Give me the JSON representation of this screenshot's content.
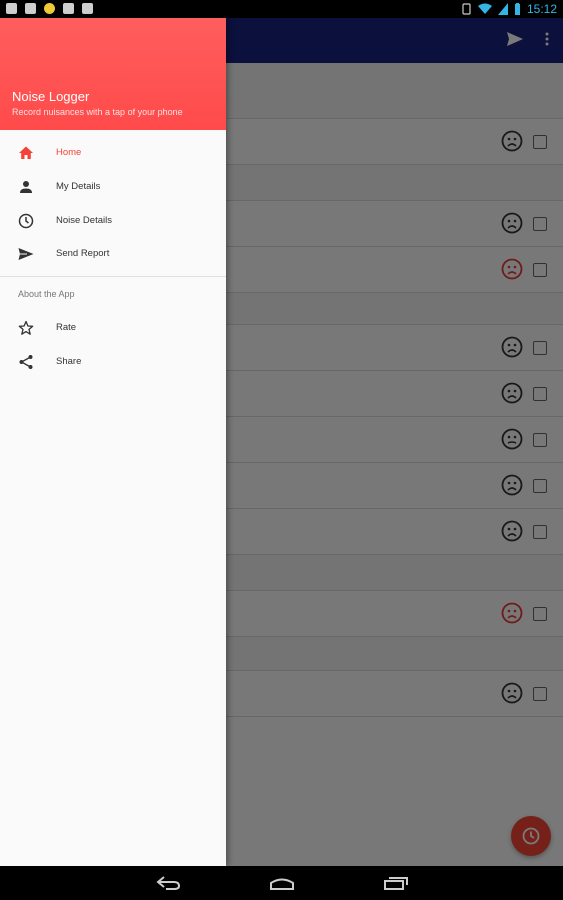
{
  "status_bar": {
    "time": "15:12"
  },
  "drawer": {
    "title": "Noise Logger",
    "subtitle": "Record nuisances with a tap of your phone",
    "items": [
      {
        "label": "Home",
        "icon": "home-icon",
        "active": true
      },
      {
        "label": "My Details",
        "icon": "person-icon"
      },
      {
        "label": "Noise Details",
        "icon": "clock-icon"
      },
      {
        "label": "Send Report",
        "icon": "send-icon"
      }
    ],
    "section_header": "About the App",
    "about_items": [
      {
        "label": "Rate",
        "icon": "star-icon"
      },
      {
        "label": "Share",
        "icon": "share-icon"
      }
    ]
  },
  "colors": {
    "accent": "#f44336",
    "header": "#ff5252",
    "appbar": "#1a237e"
  },
  "list": {
    "faces": [
      "sad-face-icon",
      "sad-face-icon",
      "angry-face-icon",
      "sad-face-icon",
      "sad-face-icon",
      "neutral-face-icon",
      "sad-face-icon",
      "sad-face-icon",
      "angry-face-icon",
      "sad-face-icon"
    ]
  }
}
